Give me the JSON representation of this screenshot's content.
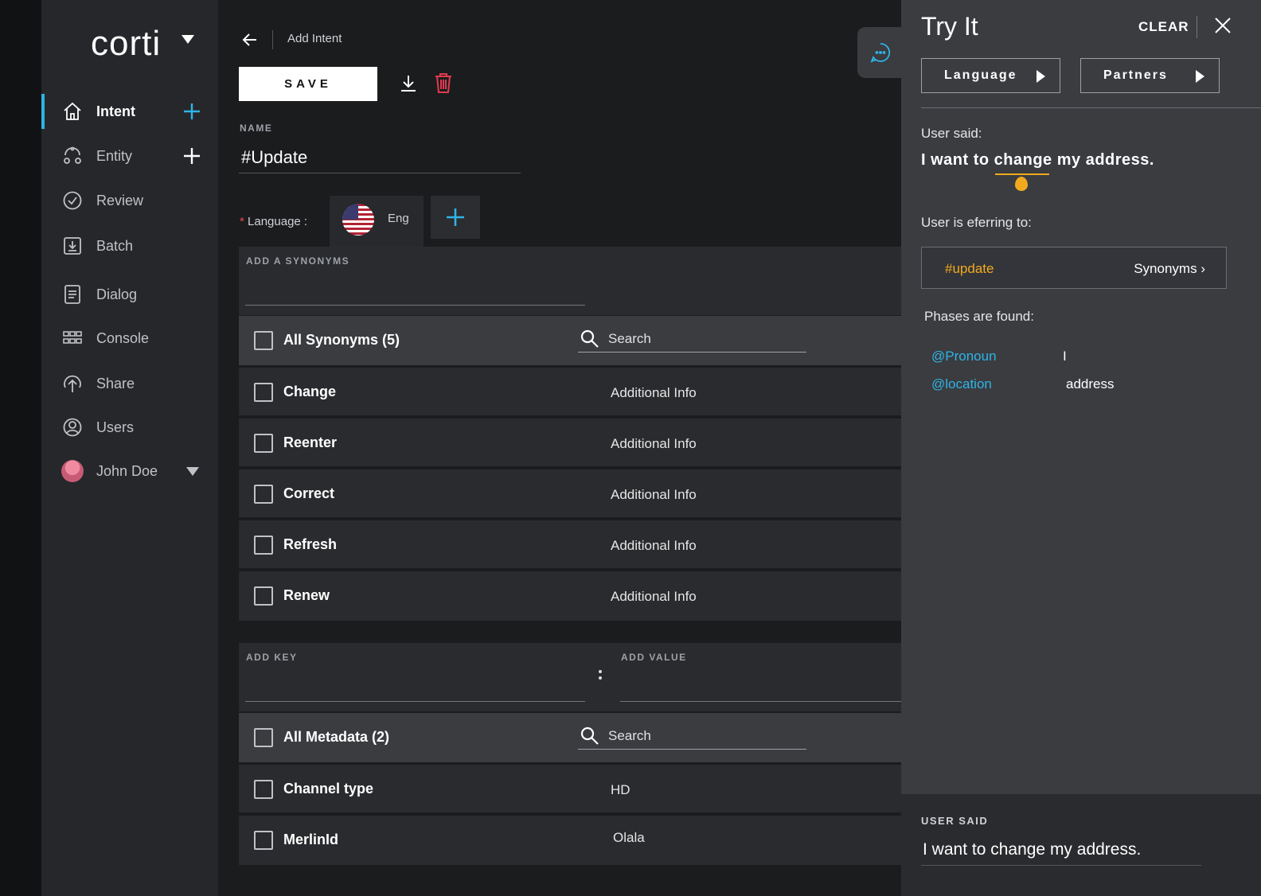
{
  "app": {
    "logo": "corti"
  },
  "sidebar": {
    "items": [
      {
        "label": "Intent"
      },
      {
        "label": "Entity"
      },
      {
        "label": "Review"
      },
      {
        "label": "Batch"
      },
      {
        "label": "Dialog"
      },
      {
        "label": "Console"
      },
      {
        "label": "Share"
      },
      {
        "label": "Users"
      }
    ],
    "user": {
      "name": "John Doe"
    },
    "accent": "#2fb4e6"
  },
  "header": {
    "breadcrumb": "Add Intent",
    "save_label": "SAVE"
  },
  "form": {
    "name_label": "NAME",
    "name_value": "#Update",
    "language_required": "*",
    "language_label": "Language :",
    "language_chip": "Eng"
  },
  "synonyms": {
    "add_label": "ADD A SYNONYMS",
    "all_label": "All Synonyms (5)",
    "search_placeholder": "Search",
    "rows": [
      {
        "label": "Change",
        "value": "Additional Info"
      },
      {
        "label": "Reenter",
        "value": "Additional Info"
      },
      {
        "label": "Correct",
        "value": "Additional Info"
      },
      {
        "label": "Refresh",
        "value": "Additional Info"
      },
      {
        "label": "Renew",
        "value": "Additional Info"
      }
    ]
  },
  "metadata": {
    "key_label": "ADD KEY",
    "value_label": "ADD VALUE",
    "all_label": "All Metadata (2)",
    "search_placeholder": "Search",
    "rows": [
      {
        "label": "Channel type",
        "value": "HD"
      },
      {
        "label": "MerlinId",
        "value": "Olala"
      }
    ]
  },
  "try_it": {
    "title": "Try It",
    "clear": "CLEAR",
    "language_btn": "Language",
    "partners_btn": "Partners",
    "user_said_label": "User said:",
    "utterance": "I want to change my address.",
    "referring_label": "User is eferring to:",
    "ref_intent": "#update",
    "ref_link": "Synonyms",
    "phases_label": "Phases are found:",
    "phases": [
      {
        "key": "@Pronoun",
        "value": "I"
      },
      {
        "key": "@location",
        "value": "address"
      }
    ],
    "footer_label": "USER SAID",
    "footer_value": "I want to change my address.",
    "highlight_color": "#f2a91e"
  }
}
